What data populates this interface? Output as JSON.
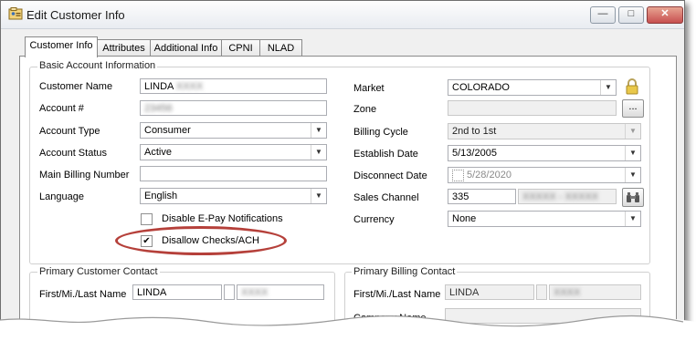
{
  "window": {
    "title": "Edit Customer Info",
    "minimize_icon": "minimize-icon",
    "maximize_icon": "maximize-icon",
    "close_icon": "close-icon"
  },
  "tabs": [
    {
      "label": "Customer Info",
      "active": true
    },
    {
      "label": "Attributes",
      "active": false
    },
    {
      "label": "Additional Info",
      "active": false
    },
    {
      "label": "CPNI",
      "active": false
    },
    {
      "label": "NLAD",
      "active": false
    }
  ],
  "basic": {
    "group_title": "Basic Account Information",
    "customer_name_label": "Customer Name",
    "customer_name_value": "LINDA",
    "customer_name_redacted": "XXXX",
    "account_label": "Account #",
    "account_redacted": "23456",
    "account_type_label": "Account Type",
    "account_type_value": "Consumer",
    "account_status_label": "Account Status",
    "account_status_value": "Active",
    "main_billing_label": "Main Billing Number",
    "main_billing_value": "",
    "language_label": "Language",
    "language_value": "English",
    "epay_label": "Disable E-Pay Notifications",
    "epay_checked": false,
    "ach_label": "Disallow Checks/ACH",
    "ach_checked": true,
    "ach_mark": "✔",
    "market_label": "Market",
    "market_value": "COLORADO",
    "zone_label": "Zone",
    "zone_value": "",
    "zone_button": "...",
    "billing_cycle_label": "Billing Cycle",
    "billing_cycle_value": "2nd to 1st",
    "establish_label": "Establish Date",
    "establish_value": "5/13/2005",
    "disconnect_label": "Disconnect Date",
    "disconnect_value": "5/28/2020",
    "sales_channel_label": "Sales Channel",
    "sales_channel_value": "335",
    "sales_channel_redacted": "XXXXX - XXXXX",
    "currency_label": "Currency",
    "currency_value": "None",
    "lock_icon": "lock-icon",
    "binoculars_icon": "binoculars-icon",
    "highlight_color": "#b5403a"
  },
  "customer_contact": {
    "group_title": "Primary Customer Contact",
    "name_label": "First/Mi./Last Name",
    "first_value": "LINDA",
    "last_redacted": "XXXX"
  },
  "billing_contact": {
    "group_title": "Primary Billing Contact",
    "name_label": "First/Mi./Last Name",
    "first_value": "LINDA",
    "last_redacted": "XXXX",
    "company_label": "Company Name",
    "company_value": ""
  }
}
